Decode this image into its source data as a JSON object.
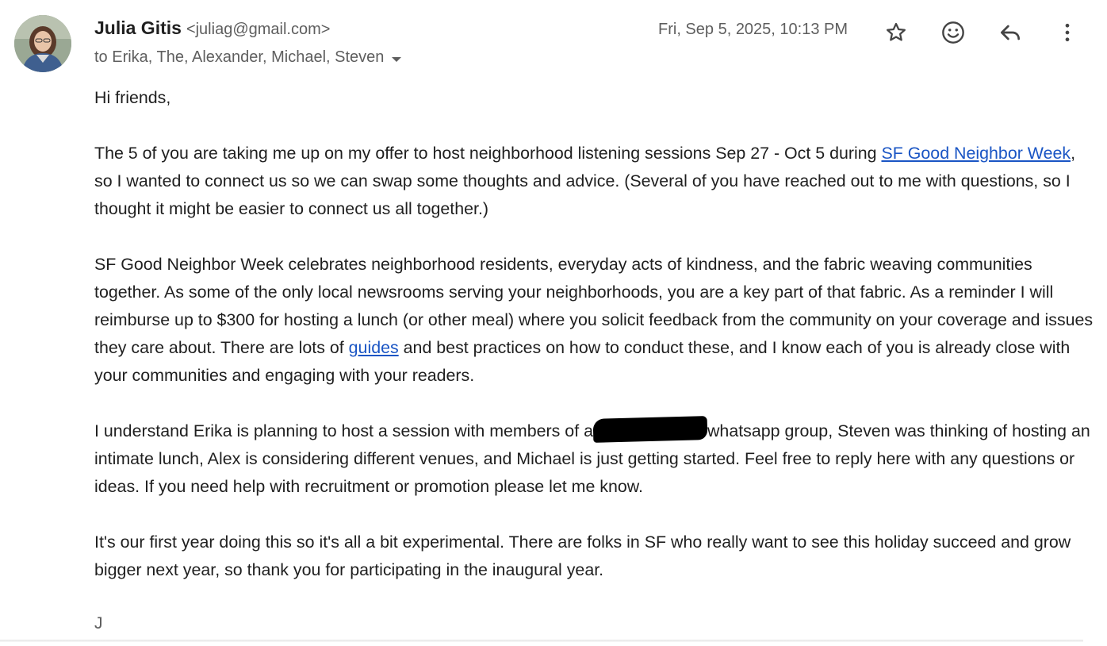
{
  "sender": {
    "name": "Julia Gitis",
    "email": "<juliag@gmail.com>",
    "avatar_icon": "user-photo"
  },
  "recipients": "to Erika, The, Alexander, Michael, Steven",
  "date": "Fri, Sep 5, 2025, 10:13 PM",
  "actions": {
    "star_icon": "star-icon",
    "emoji_icon": "emoji-reaction-icon",
    "reply_icon": "reply-icon",
    "more_icon": "more-vert-icon"
  },
  "body": {
    "greeting": "Hi friends,",
    "p1": {
      "before_link": "The 5 of you are taking me up on my offer to host neighborhood listening sessions Sep 27 - Oct 5 during ",
      "link_text": "SF Good Neighbor Week",
      "after_link": ", so I wanted to connect us so we can swap some thoughts and advice. (Several of you have reached out to me with questions, so I thought it might be easier to connect us all together.)"
    },
    "p2": {
      "before_link": "SF Good Neighbor Week celebrates neighborhood residents, everyday acts of kindness, and the fabric weaving communities together. As some of the only local newsrooms serving your neighborhoods, you are a key part of that fabric. As a reminder I will reimburse up to $300 for hosting a lunch (or other meal) where you solicit feedback from the community on your coverage and issues they care about. There are lots of ",
      "link_text": "guides",
      "after_link": " and best practices on how to conduct these, and I know each of you is already close with your communities and engaging with your readers."
    },
    "p3": {
      "before_redaction": "I understand Erika is planning to host a session with members of a",
      "after_redaction": "whatsapp group, Steven was thinking of hosting an intimate lunch, Alex is considering different venues, and Michael is just getting started. Feel free to reply here with any questions or ideas. If you need help with recruitment or promotion please let me know."
    },
    "p4": "It's our first year doing this so it's all a bit experimental. There are folks in SF who really want to see this holiday succeed and grow bigger next year, so thank you for participating in the inaugural year."
  },
  "signature": "J",
  "colors": {
    "link": "#1a55c4",
    "text": "#1f1f1f",
    "muted": "#5e5e5e"
  }
}
